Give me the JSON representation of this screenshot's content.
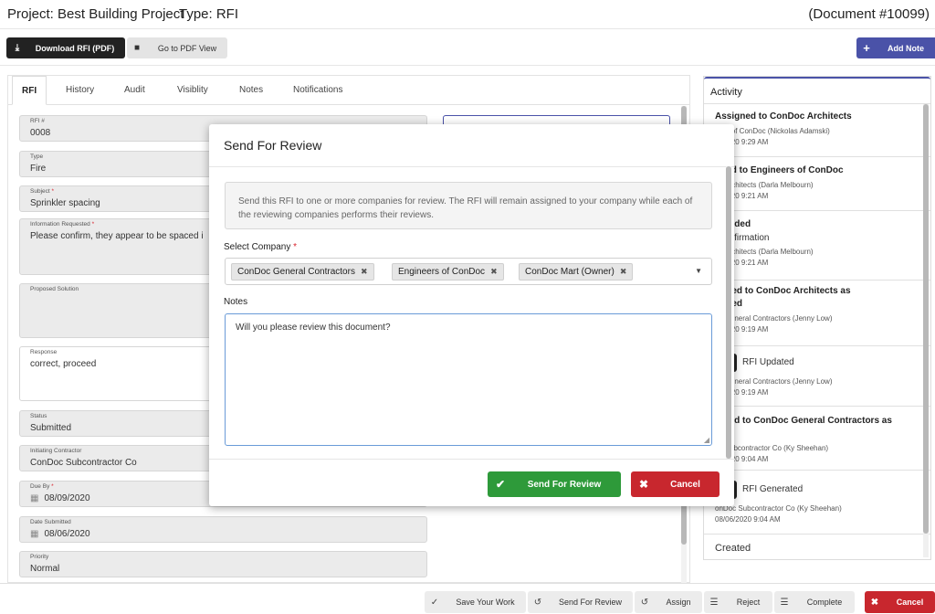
{
  "header": {
    "project": "Project: Best Building Project",
    "type": "Type: RFI",
    "document_number": "(Document #10099)"
  },
  "toolbar": {
    "download_label": "Download RFI (PDF)",
    "pdf_view_label": "Go to PDF View",
    "add_note_label": "Add Note"
  },
  "tabs": [
    "RFI",
    "History",
    "Audit",
    "Visiblity",
    "Notes",
    "Notifications"
  ],
  "form": {
    "rfi_label": "RFI #",
    "rfi_value": "0008",
    "type_label": "Type",
    "type_value": "Fire",
    "subject_label": "Subject",
    "subject_value": "Sprinkler spacing",
    "info_label": "Information Requested",
    "info_value": "Please confirm, they appear to be spaced i",
    "proposed_label": "Proposed Solution",
    "response_label": "Response",
    "response_value": "correct, proceed",
    "status_label": "Status",
    "status_value": "Submitted",
    "initiating_label": "Initiating Contractor",
    "initiating_value": "ConDoc Subcontractor Co",
    "due_label": "Due By",
    "due_value": "08/09/2020",
    "submitted_label": "Date Submitted",
    "submitted_value": "08/06/2020",
    "priority_label": "Priority",
    "priority_value": "Normal"
  },
  "activity": {
    "title": "Activity",
    "items": [
      {
        "title": "Assigned to ConDoc Architects",
        "sub": "eers of ConDoc (Nickolas Adamski)",
        "date": "/6/2020 9:29 AM"
      },
      {
        "title": "gned to Engineers of ConDoc",
        "sub": "oc Architects (Darla Melbourn)",
        "date": "/6/2020 9:21 AM"
      },
      {
        "title": "e Added",
        "line2": "l confirmation",
        "sub": "oc Architects (Darla Melbourn)",
        "date": "/6/2020 9:21 AM"
      },
      {
        "title": "mitted to ConDoc Architects as",
        "title2": "mitted",
        "sub": "oc General Contractors (Jenny Low)",
        "date": "/6/2020 9:19 AM"
      },
      {
        "badge": "RFI Updated",
        "sub": "oc General Contractors (Jenny Low)",
        "date": "/6/2020 9:19 AM"
      },
      {
        "title": "nitted to ConDoc General Contractors as",
        "sub": "oc Subcontractor Co (Ky Sheehan)",
        "date": "/6/2020 9:04 AM"
      },
      {
        "badge": "RFI Generated",
        "sub": "onDoc Subcontractor Co (Ky Sheehan)",
        "date": "08/06/2020 9:04 AM"
      },
      {
        "title": "Created"
      }
    ]
  },
  "bottom": {
    "save": "Save Your Work",
    "send": "Send For Review",
    "assign": "Assign",
    "reject": "Reject",
    "complete": "Complete",
    "cancel": "Cancel"
  },
  "modal": {
    "title": "Send For Review",
    "info": "Send this RFI to one or more companies for review. The RFI will remain assigned to your company while each of the reviewing companies performs their reviews.",
    "company_label": "Select Company",
    "companies": [
      "ConDoc General Contractors",
      "Engineers of ConDoc",
      "ConDoc Mart (Owner)"
    ],
    "notes_label": "Notes",
    "notes_value": "Will you please review this document?",
    "send_label": "Send For Review",
    "cancel_label": "Cancel"
  },
  "colors": {
    "accent": "#4a52a8",
    "success": "#2e9a3a",
    "danger": "#c8272e",
    "dark": "#222222"
  },
  "icons": {
    "download": "download-icon",
    "pdf": "file-icon",
    "add": "plus-icon",
    "check": "check-icon",
    "undo": "undo-icon",
    "list": "list-icon",
    "close": "close-icon",
    "calendar": "calendar-icon"
  }
}
